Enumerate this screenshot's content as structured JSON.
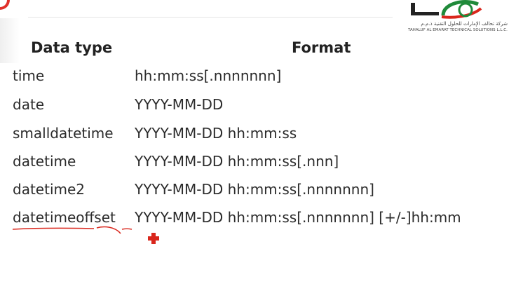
{
  "logo": {
    "arabic_text": "شركة تحالف الإمارات للحلول التقنية ذ.م.م",
    "english_text": "TAHALUF AL EMARAT TECHNICAL SOLUTIONS L.L.C.",
    "colors": {
      "green": "#1f8a3a",
      "red": "#d9261c",
      "dark": "#222222"
    }
  },
  "table": {
    "headers": {
      "type": "Data type",
      "format": "Format"
    },
    "rows": [
      {
        "type": "time",
        "format": "hh:mm:ss[.nnnnnnn]"
      },
      {
        "type": "date",
        "format": "YYYY-MM-DD"
      },
      {
        "type": "smalldatetime",
        "format": "YYYY-MM-DD hh:mm:ss"
      },
      {
        "type": "datetime",
        "format": "YYYY-MM-DD hh:mm:ss[.nnn]"
      },
      {
        "type": "datetime2",
        "format": "YYYY-MM-DD hh:mm:ss[.nnnnnnn]"
      },
      {
        "type": "datetimeoffset",
        "format": "YYYY-MM-DD hh:mm:ss[.nnnnnnn] [+/-]hh:mm"
      }
    ]
  },
  "annotation": {
    "underlined_row": "datetimeoffset",
    "pen_color": "#d9261c"
  }
}
